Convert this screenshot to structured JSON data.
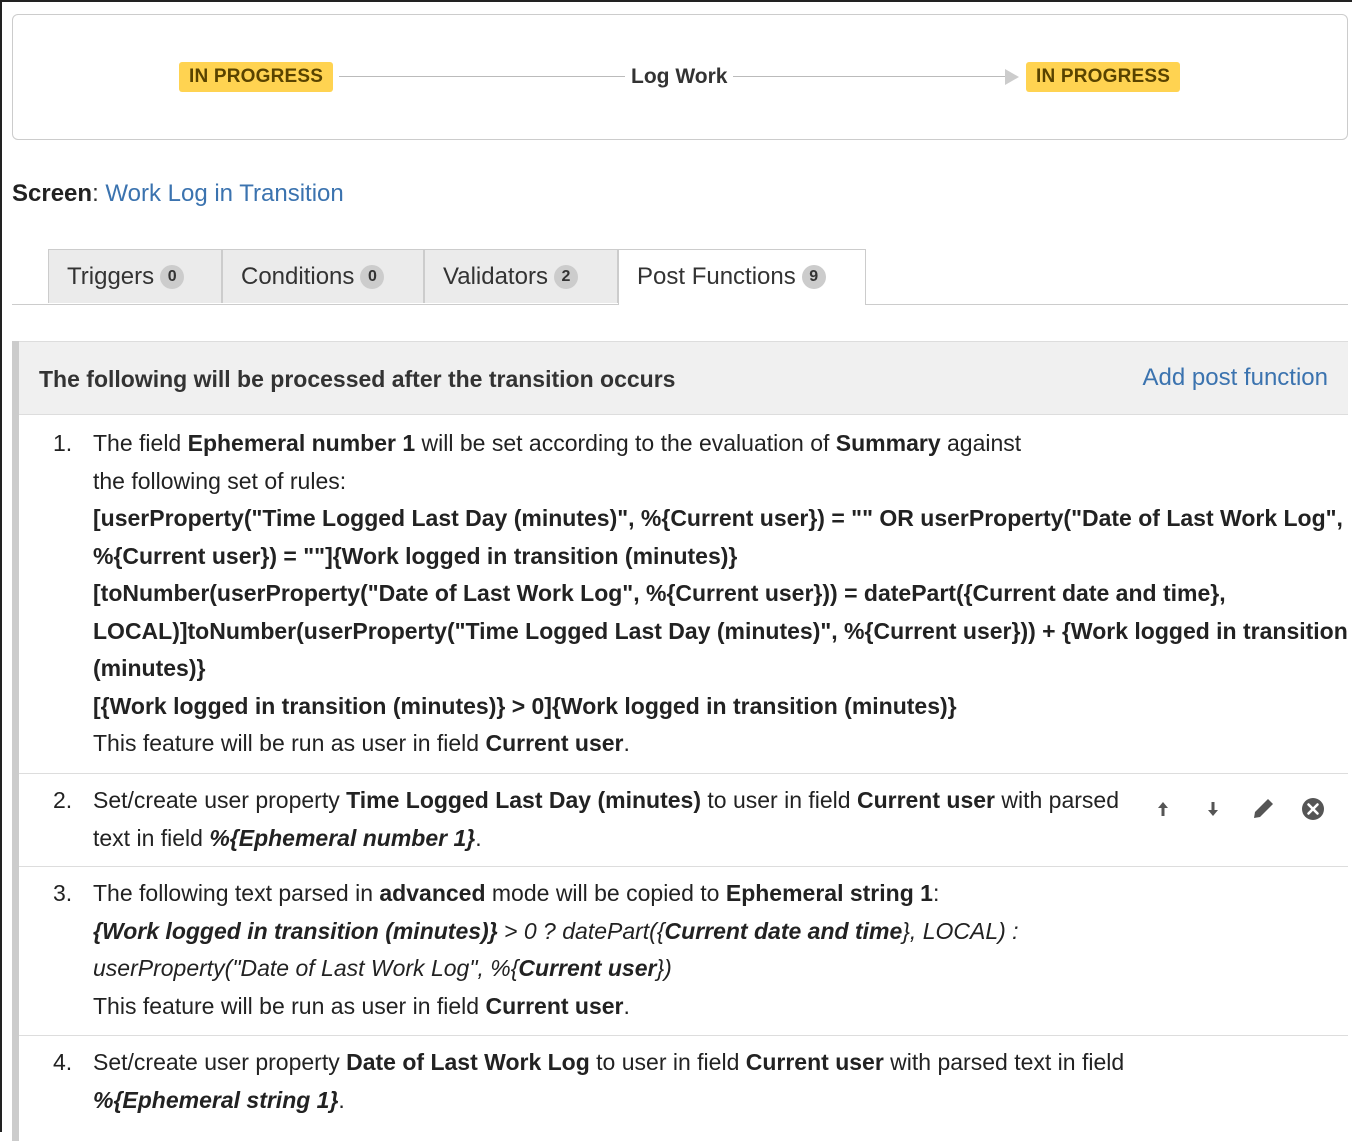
{
  "transition": {
    "from_status": "IN PROGRESS",
    "name": "Log Work",
    "to_status": "IN PROGRESS"
  },
  "screen": {
    "label": "Screen",
    "link": "Work Log in Transition"
  },
  "tabs": [
    {
      "label": "Triggers",
      "count": "0"
    },
    {
      "label": "Conditions",
      "count": "0"
    },
    {
      "label": "Validators",
      "count": "2"
    },
    {
      "label": "Post Functions",
      "count": "9"
    }
  ],
  "panel": {
    "title": "The following will be processed after the transition occurs",
    "add_link": "Add post function"
  },
  "items": [
    {
      "number": "1."
    },
    {
      "number": "2."
    },
    {
      "number": "3."
    },
    {
      "number": "4."
    }
  ],
  "icons": {
    "move_up": "arrow-up-icon",
    "move_down": "arrow-down-icon",
    "edit": "pencil-icon",
    "delete": "close-circle-icon"
  },
  "colors": {
    "status_lozenge": "#ffd351",
    "link": "#3b73af"
  }
}
